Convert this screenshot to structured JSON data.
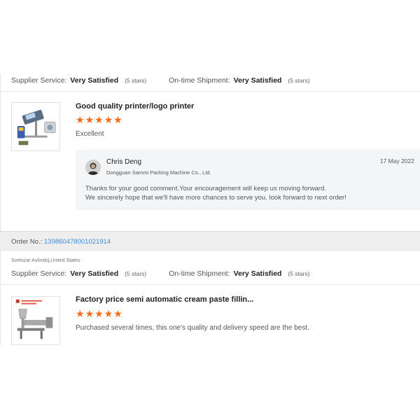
{
  "review1": {
    "supplier_service_label": "Supplier Service:",
    "supplier_service_value": "Very Satisfied",
    "supplier_service_stars": "(5 stars)",
    "shipment_label": "On-time Shipment:",
    "shipment_value": "Very Satisfied",
    "shipment_stars": "(5 stars)",
    "product_title": "Good quality printer/logo printer",
    "rating": 5,
    "comment": "Excellent",
    "reply": {
      "name": "Chris Deng",
      "company": "Dongguan Sammi Packing Machine Co., Ltd.",
      "date": "17 May 2022",
      "line1": "Thanks for your good comment.Your encouragement will keep us moving forward.",
      "line2": "We sincerely hope that we'll have more chances to serve you. look forward to next order!"
    }
  },
  "order": {
    "label": "Order No.:",
    "number": "139860478001021914"
  },
  "review2": {
    "buyer": "Svetozar Avlinskij,United States",
    "supplier_service_label": "Supplier Service:",
    "supplier_service_value": "Very Satisfied",
    "supplier_service_stars": "(5 stars)",
    "shipment_label": "On-time Shipment:",
    "shipment_value": "Very Satisfied",
    "shipment_stars": "(5 stars)",
    "product_title": "Factory price semi automatic cream paste fillin...",
    "rating": 5,
    "comment": "Purchased several times, this one's quality and delivery speed are the best."
  },
  "colors": {
    "star": "#f56a1a",
    "link": "#3b8ed8"
  },
  "icons": {
    "star": "star-icon",
    "avatar": "user-avatar"
  }
}
